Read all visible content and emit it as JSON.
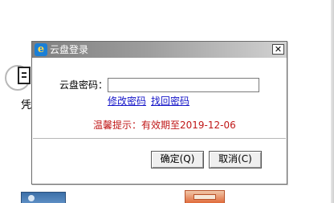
{
  "background": {
    "desktop_label": "凭"
  },
  "dialog": {
    "title": "云盘登录",
    "app_icon_glyph": "e",
    "close_glyph": "✕",
    "password_label": "云盘密码：",
    "password_value": "",
    "change_password_link": "修改密码",
    "recover_password_link": "找回密码",
    "tip": "温馨提示：有效期至2019-12-06",
    "ok_button": "确定(Q)",
    "cancel_button": "取消(C)"
  },
  "colors": {
    "tip": "#c01818",
    "link": "#1515c8",
    "titlebar_start": "#7f7f7f",
    "titlebar_end": "#d2d2d2"
  }
}
